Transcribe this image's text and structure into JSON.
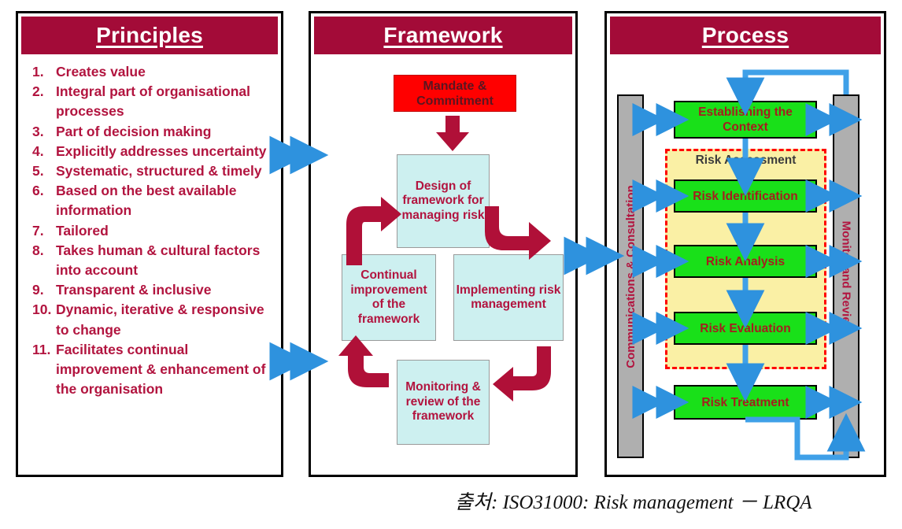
{
  "caption": "출처: ISO31000: Risk management － LRQA",
  "colors": {
    "header_crimson": "#A30B38",
    "text_crimson": "#B2143F",
    "mandate_red": "#FF0000",
    "framework_box_blue": "#CDF0F0",
    "process_box_green": "#19E019",
    "risk_assessment_yellow": "#FAF0A5",
    "sidebar_gray": "#AFAFAF",
    "connector_blue": "#2E92DE",
    "arrow_crimson": "#B01038",
    "dashed_red": "#FF0000"
  },
  "principles": {
    "title": "Principles",
    "items": [
      {
        "num": "1.",
        "text": "Creates value"
      },
      {
        "num": "2.",
        "text": "Integral part of organisational processes"
      },
      {
        "num": "3.",
        "text": "Part of decision making"
      },
      {
        "num": "4.",
        "text": "Explicitly addresses uncertainty"
      },
      {
        "num": "5.",
        "text": "Systematic, structured & timely"
      },
      {
        "num": "6.",
        "text": "Based on the best available information"
      },
      {
        "num": "7.",
        "text": "Tailored"
      },
      {
        "num": "8.",
        "text": "Takes human & cultural factors into account"
      },
      {
        "num": "9.",
        "text": "Transparent & inclusive"
      },
      {
        "num": "10.",
        "text": "Dynamic, iterative & responsive to change"
      },
      {
        "num": "11.",
        "text": "Facilitates continual improvement & enhancement of the organisation"
      }
    ]
  },
  "framework": {
    "title": "Framework",
    "mandate": "Mandate & Commitment",
    "design": "Design of framework for managing risk",
    "implementing": "Implementing risk management",
    "monitoring": "Monitoring & review of the framework",
    "continual": "Continual improvement of the framework"
  },
  "process": {
    "title": "Process",
    "left_bar": "Communications & Consultation",
    "right_bar": "Monitor and Review",
    "risk_assessment_label": "Risk Assessment",
    "steps": [
      {
        "label": "Establishing the Context"
      },
      {
        "label": "Risk Identification"
      },
      {
        "label": "Risk Analysis"
      },
      {
        "label": "Risk Evaluation"
      },
      {
        "label": "Risk Treatment"
      }
    ]
  }
}
